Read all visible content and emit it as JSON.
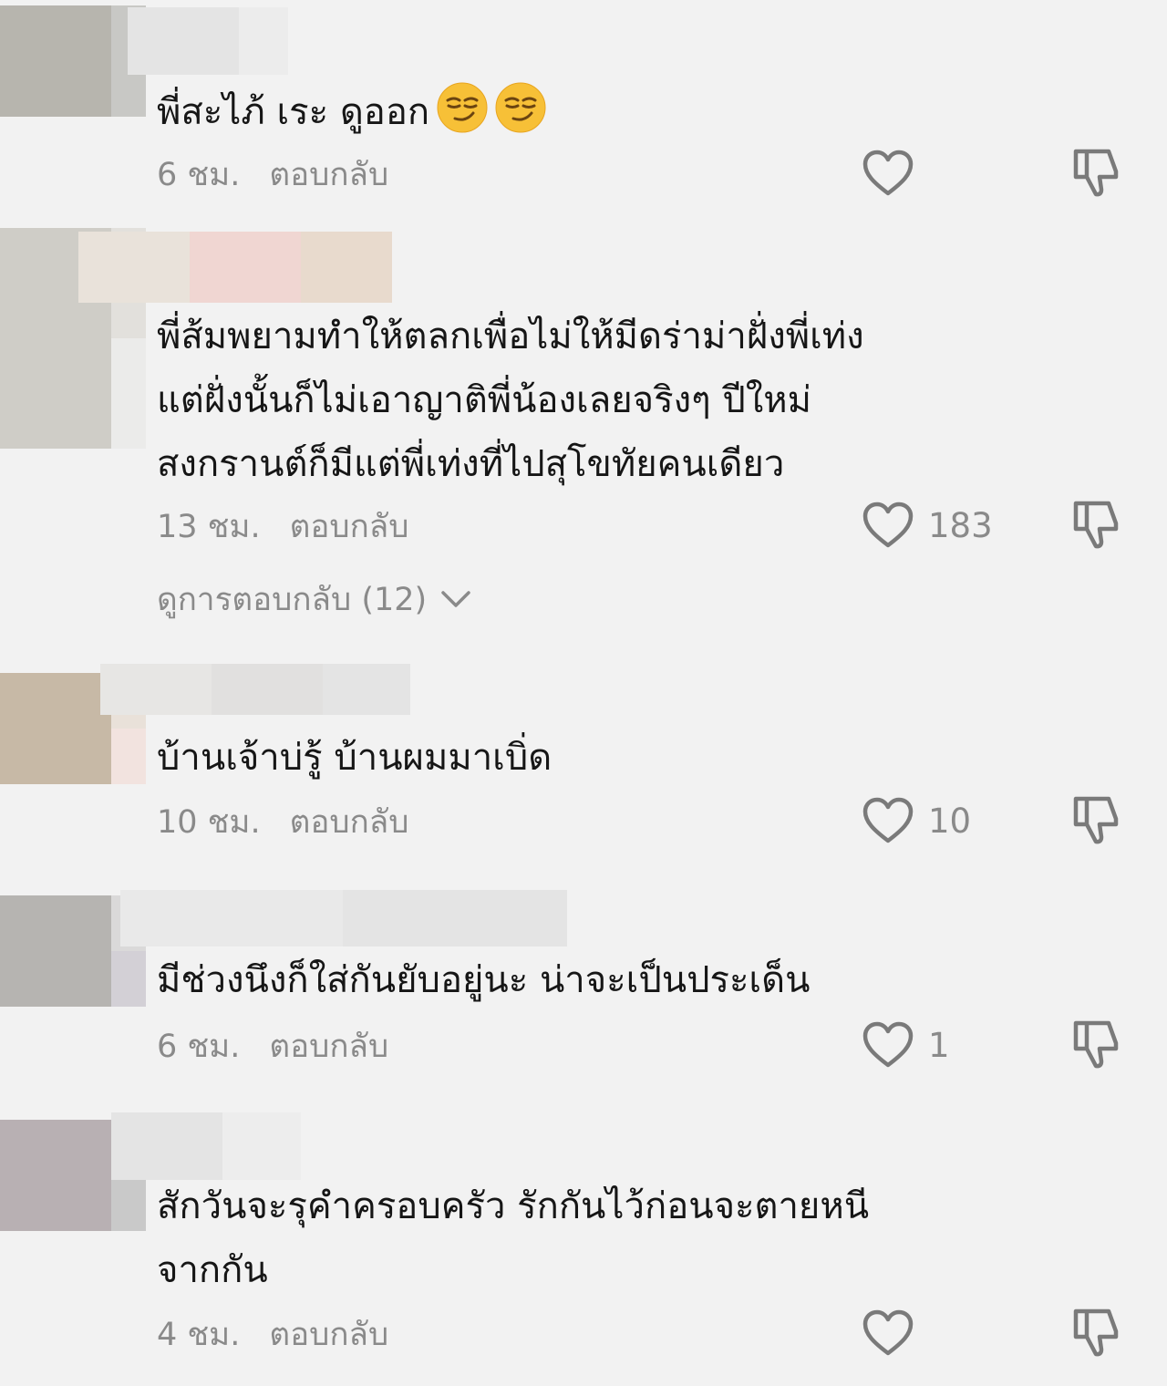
{
  "comments": [
    {
      "text": "พี่สะไภ้ เระ ดูออก",
      "emoji_count": 2,
      "emoji": "smirking-face-emoji",
      "time": "6 ชม.",
      "reply_label": "ตอบกลับ",
      "likes": "",
      "avatar_colors": [
        "#b7b5ae",
        "#c8c8c5",
        "#d4d4d2"
      ],
      "name_colors": [
        "#e4e4e4",
        "#ececec"
      ]
    },
    {
      "text": "พี่ส้มพยามทำให้ตลกเพื่อไม่ให้มีดร่าม่าฝั่งพี่เท่ง\nแต่ฝั่งนั้นก็ไม่เอาญาติพี่น้องเลยจริงๆ ปีใหม่\nสงกรานต์ก็มีแต่พี่เท่งที่ไปสุโขทัยคนเดียว",
      "time": "13 ชม.",
      "reply_label": "ตอบกลับ",
      "likes": "183",
      "view_replies": "ดูการตอบกลับ (12)",
      "avatar_colors": [
        "#cfcdc7",
        "#e2e0dc",
        "#ebebea"
      ],
      "name_colors": [
        "#e9e2da",
        "#f0d6d2",
        "#e8dacd"
      ]
    },
    {
      "text": "บ้านเจ้าบ่รู้ บ้านผมมาเบิ่ด",
      "time": "10 ชม.",
      "reply_label": "ตอบกลับ",
      "likes": "10",
      "avatar_colors": [
        "#c7b9a6",
        "#e9e1d9",
        "#f2e3df"
      ],
      "name_colors": [
        "#e7e6e4",
        "#e1e0df",
        "#e4e4e4"
      ]
    },
    {
      "text": "มีช่วงนึงก็ใส่กันยับอยู่นะ น่าจะเป็นประเด็น",
      "time": "6 ชม.",
      "reply_label": "ตอบกลับ",
      "likes": "1",
      "avatar_colors": [
        "#b6b4b1",
        "#dad9d9",
        "#d3d0d6"
      ],
      "name_colors": [
        "#e9e9e9",
        "#e4e4e4"
      ]
    },
    {
      "text": "สักวันจะรุคำครอบครัว รักกันไว้ก่อนจะตายหนี\nจากกัน",
      "time": "4 ชม.",
      "reply_label": "ตอบกลับ",
      "likes": "",
      "avatar_colors": [
        "#b8b0b3",
        "#dededd",
        "#c9c9c9"
      ],
      "name_colors": [
        "#e4e4e4",
        "#ededed"
      ]
    }
  ],
  "colors": {
    "background": "#f2f2f2",
    "text": "#161616",
    "meta": "#8a8a8a",
    "icon": "#7a7a7a"
  }
}
